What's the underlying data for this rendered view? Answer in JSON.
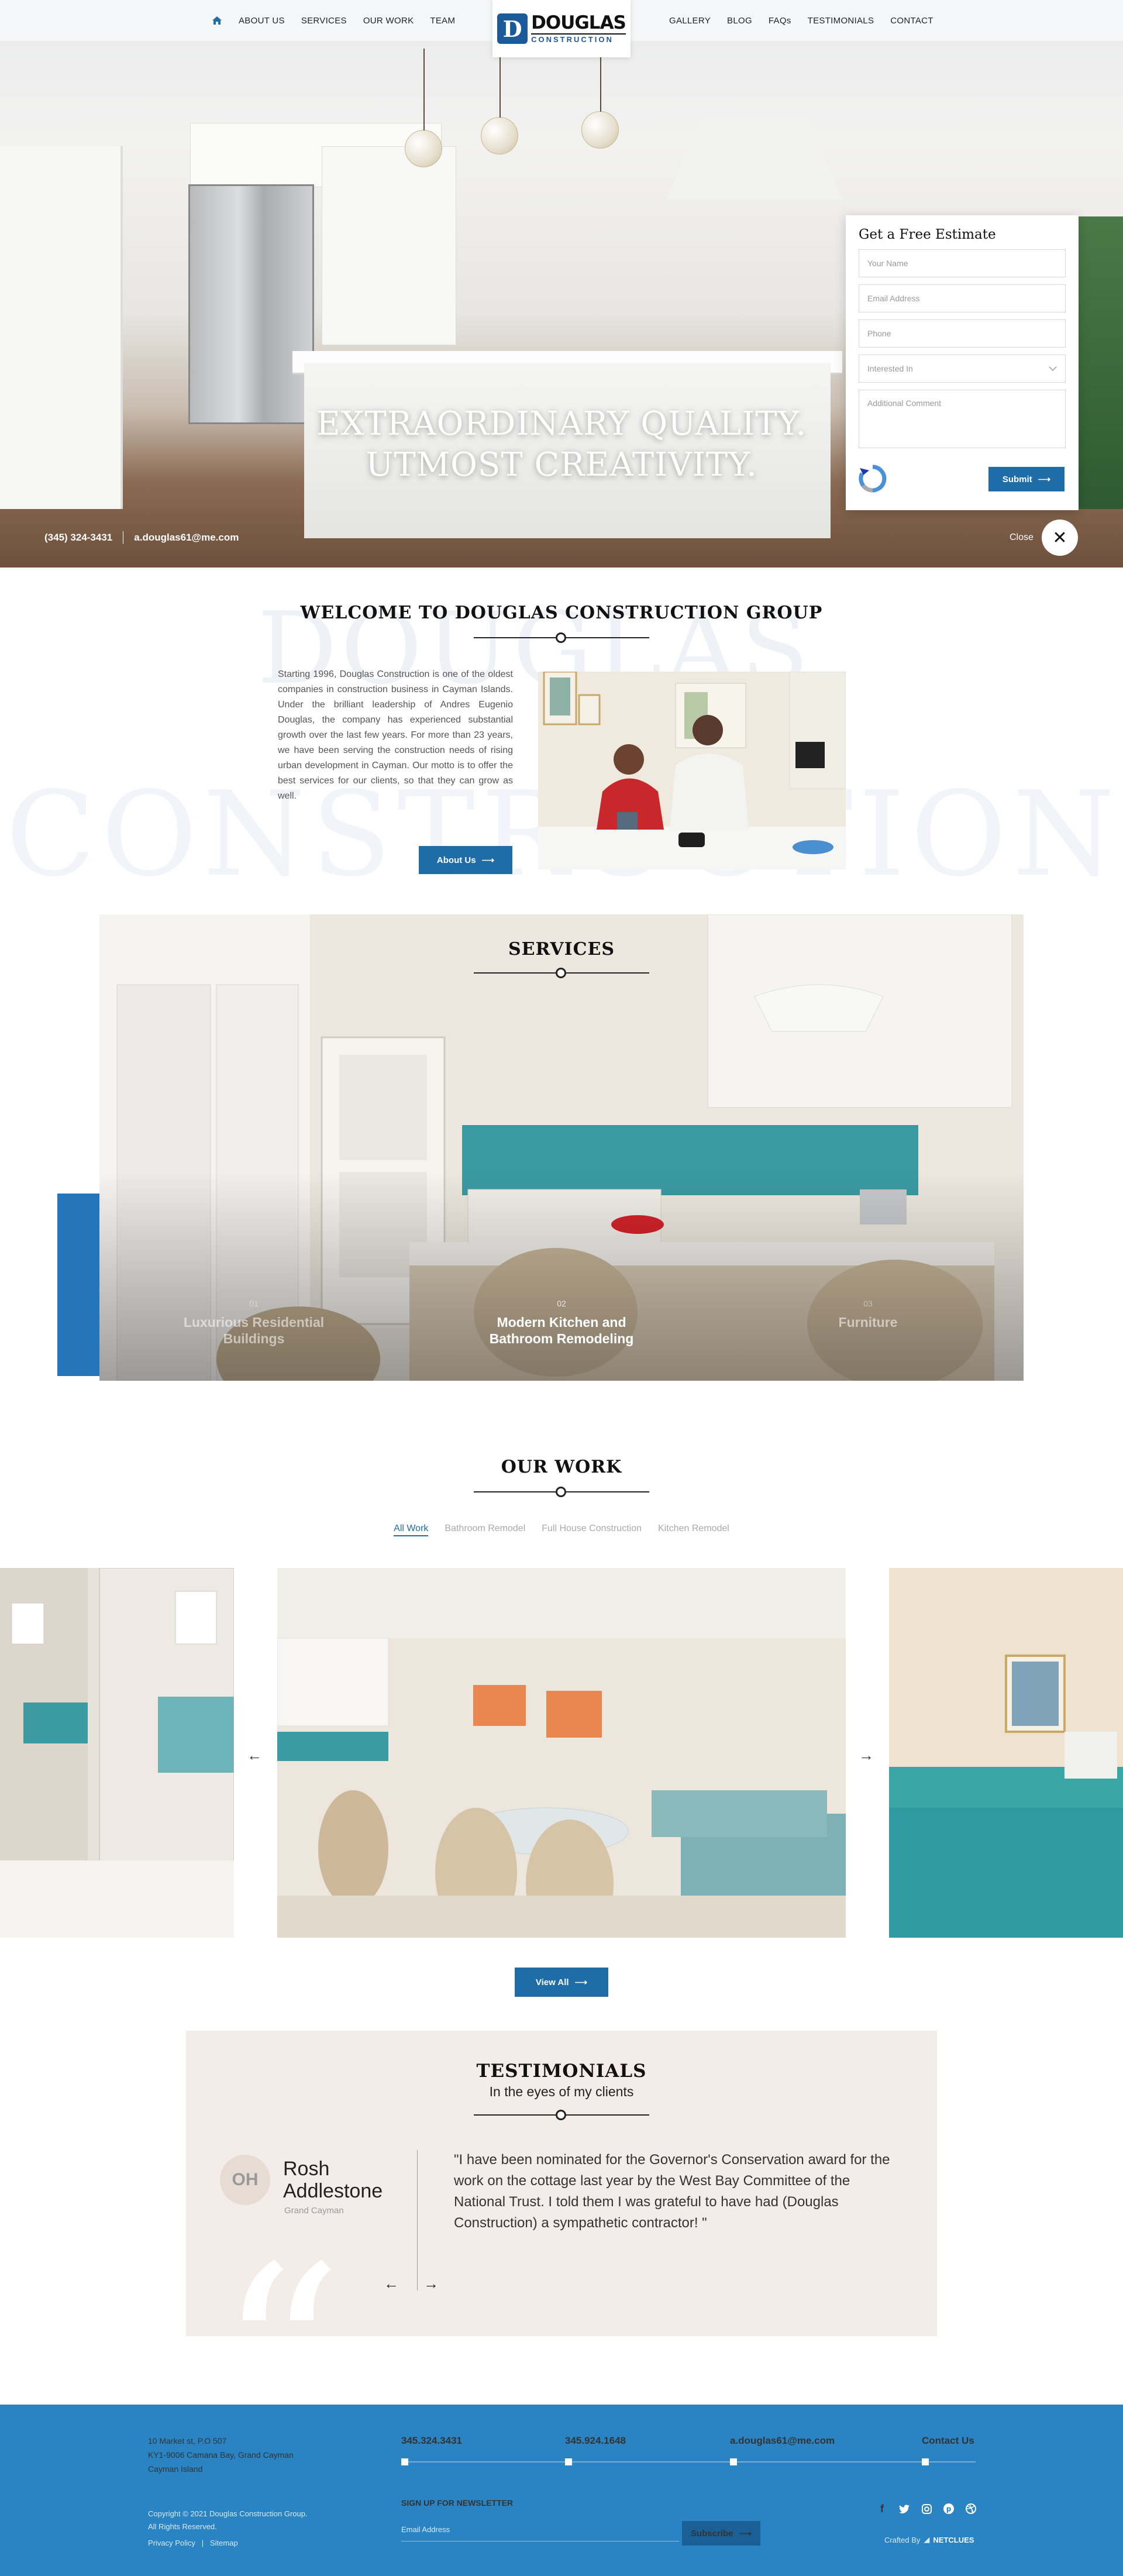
{
  "header": {
    "nav_left": [
      "ABOUT US",
      "SERVICES",
      "OUR WORK",
      "TEAM"
    ],
    "nav_right": [
      "GALLERY",
      "BLOG",
      "FAQs",
      "TESTIMONIALS",
      "CONTACT"
    ],
    "logo_line1": "DOUGLAS",
    "logo_line2": "CONSTRUCTION",
    "logo_mark": "D"
  },
  "hero": {
    "title_line1": "EXTRAORDINARY QUALITY.",
    "title_line2": "UTMOST CREATIVITY.",
    "phone": "(345) 324-3431",
    "email": "a.douglas61@me.com",
    "close_label": "Close"
  },
  "estimate_form": {
    "title": "Get a Free Estimate",
    "name_placeholder": "Your Name",
    "email_placeholder": "Email Address",
    "phone_placeholder": "Phone",
    "interest_placeholder": "Interested In",
    "comment_placeholder": "Additional Comment",
    "submit_label": "Submit"
  },
  "welcome": {
    "watermark1": "DOUGLAS",
    "watermark2": "CONSTRUCTION",
    "title": "WELCOME TO DOUGLAS CONSTRUCTION GROUP",
    "body": "Starting 1996, Douglas Construction is one of the oldest companies in construction business in Cayman Islands. Under the brilliant leadership of Andres Eugenio Douglas, the company has experienced substantial growth over the last few years.  For more than 23 years, we have been serving the construction needs of rising urban development in Cayman. Our motto is to offer the best services for our clients, so that they can grow as well.",
    "button_label": "About Us"
  },
  "services": {
    "title": "SERVICES",
    "items": [
      {
        "num": "01",
        "name_l1": "Luxurious Residential",
        "name_l2": "Buildings"
      },
      {
        "num": "02",
        "name_l1": "Modern Kitchen and",
        "name_l2": "Bathroom Remodeling"
      },
      {
        "num": "03",
        "name_l1": "Furniture",
        "name_l2": ""
      }
    ]
  },
  "our_work": {
    "title": "OUR WORK",
    "tabs": [
      "All Work",
      "Bathroom Remodel",
      "Full House Construction",
      "Kitchen Remodel"
    ],
    "view_all_label": "View All"
  },
  "testimonials": {
    "title": "TESTIMONIALS",
    "subtitle": "In the eyes of my clients",
    "initials": "OH",
    "name_l1": "Rosh",
    "name_l2": "Addlestone",
    "location": "Grand Cayman",
    "quote": "\"I have been nominated for the Governor's Conservation award for the work on the cottage last year by the West Bay Committee of the National Trust. I told them I was grateful to have had (Douglas Construction) a sympathetic contractor! \""
  },
  "footer": {
    "address_l1": "10 Market st, P.O 507",
    "address_l2": "KY1-9006 Camana Bay, Grand Cayman",
    "address_l3": "Cayman Island",
    "phone1": "345.324.3431",
    "phone2": "345.924.1648",
    "email": "a.douglas61@me.com",
    "contact_label": "Contact Us",
    "copyright_l1": "Copyright © 2021 Douglas Construction Group.",
    "copyright_l2": "All Rights Reserved.",
    "privacy_label": "Privacy Policy",
    "sitemap_label": "Sitemap",
    "newsletter_label": "SIGN UP FOR NEWSLETTER",
    "newsletter_placeholder": "Email Address",
    "subscribe_label": "Subscribe",
    "crafted_by_label": "Crafted By",
    "crafted_by_name": "NETCLUES"
  },
  "colors": {
    "brand_blue": "#1e6ca8",
    "footer_blue": "#2a83c2",
    "testimonial_bg": "#f4ece8"
  }
}
